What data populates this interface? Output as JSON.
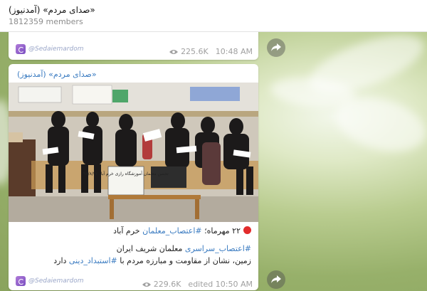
{
  "channel": {
    "title": "(صدای مردم» (آمدنیوز»",
    "members": "1812359 members"
  },
  "post_prev": {
    "signature": "@Sedaiemardom",
    "views": "225.6K",
    "time": "10:48 AM"
  },
  "post": {
    "author": "(صدای مردم» (آمدنیوز»",
    "sign_text": "تحصن معلمان آموزشگاه رازی خرم آباد ۹۷/۸/۲۲",
    "caption_line1_text": "۲۲ مهرماه؛ ",
    "caption_line1_hash": "#اعتصاب_معلمان",
    "caption_line1_tail": " خرم آباد",
    "caption_line2_hash": "#اعتصاب_سراسری",
    "caption_line2_tail": " معلمان شریف ایران",
    "caption_line3_text": "زمین، نشان از مقاومت و مبارزه مردم با ",
    "caption_line3_hash": "#استبداد_دینی",
    "caption_line3_tail": " دارد",
    "signature": "@Sedaiemardom",
    "views": "229.6K",
    "time": "edited 10:50 AM"
  },
  "colors": {
    "link": "#3a7bc1",
    "accent_red": "#e22b2b"
  }
}
